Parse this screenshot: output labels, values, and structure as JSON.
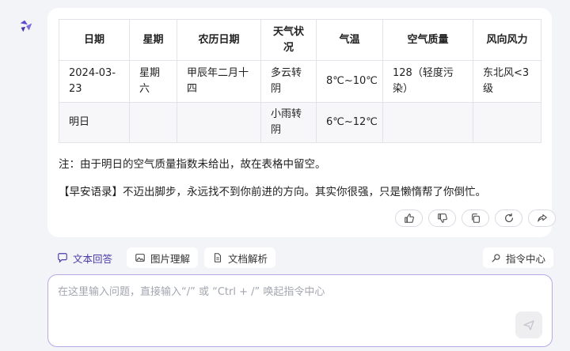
{
  "table": {
    "headers": [
      "日期",
      "星期",
      "农历日期",
      "天气状况",
      "气温",
      "空气质量",
      "风向风力"
    ],
    "rows": [
      [
        "2024-03-23",
        "星期六",
        "甲辰年二月十四",
        "多云转阴",
        "8℃~10℃",
        "128（轻度污染）",
        "东北风<3级"
      ],
      [
        "明日",
        "",
        "",
        "小雨转阴",
        "6℃~12℃",
        "",
        ""
      ]
    ]
  },
  "note": "注：由于明日的空气质量指数未给出，故在表格中留空。",
  "quote": "【早安语录】不迈出脚步，永远找不到你前进的方向。其实你很强，只是懒惰帮了你倒忙。",
  "tabs": {
    "text_qa": "文本回答",
    "image_understanding": "图片理解",
    "doc_parse": "文档解析"
  },
  "command_center": "指令中心",
  "input": {
    "placeholder": "在这里输入问题，直接输入“/” 或 “Ctrl + /” 唤起指令中心"
  },
  "colors": {
    "accent": "#4a3aa8",
    "border": "#b8a9e6"
  },
  "icons": [
    "logo-icon",
    "thumbs-up-icon",
    "thumbs-down-icon",
    "copy-icon",
    "refresh-icon",
    "share-icon",
    "chat-icon",
    "image-icon",
    "document-icon",
    "command-icon",
    "send-icon"
  ]
}
